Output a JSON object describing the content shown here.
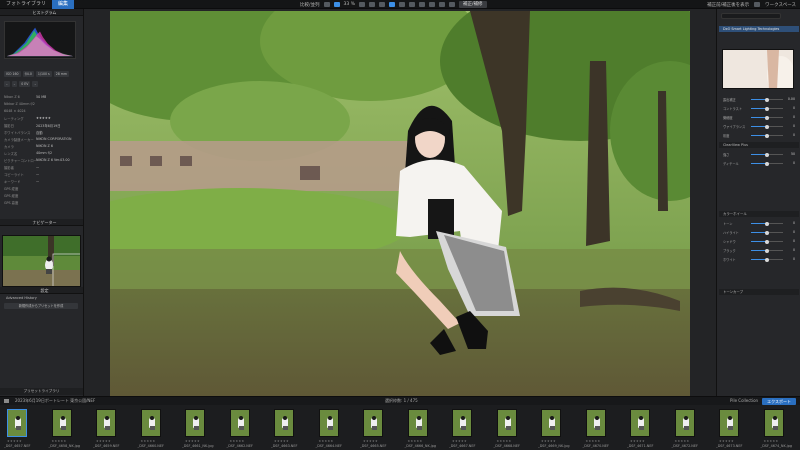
{
  "topbar": {
    "tabs": [
      "フォトライブラリ",
      "編集"
    ],
    "active_tab": "編集",
    "zoom": "33 %",
    "compare_label": "比較/並列",
    "tool_button": "補正/補修",
    "right_label": "補正前/補正後を表示",
    "right_label2": "ワークスペース"
  },
  "left_panel": {
    "histogram_title": "ヒストグラム",
    "buttons_row1": [
      "ISO 160",
      "1/60",
      "1/100 s",
      "28 mm",
      "f/4.0"
    ],
    "buttons_row2": [
      "–",
      "–",
      "0 EV",
      "–"
    ],
    "meta": [
      {
        "k": "Nikon Z 6",
        "v": "50 MB"
      },
      {
        "k": "Nikkor Z 40mm f/2",
        "v": ""
      },
      {
        "k": "6048 × 4024",
        "v": ""
      },
      {
        "k": "レーティング",
        "v": "★★★★★"
      },
      {
        "k": "撮影日",
        "v": "2023年6月19日"
      },
      {
        "k": "ホワイトバランス",
        "v": "自動"
      },
      {
        "k": "カメラ製造メーカー",
        "v": "NIKON CORPORATION"
      },
      {
        "k": "カメラ",
        "v": "NIKON Z 6"
      },
      {
        "k": "レンズ名",
        "v": "40mm f/2"
      },
      {
        "k": "ピクチャーコントロール",
        "v": "NIKON Z 6 Ver.03.00"
      },
      {
        "k": "撮影者",
        "v": "—"
      },
      {
        "k": "コピーライト",
        "v": "—"
      },
      {
        "k": "キーワード",
        "v": "—"
      },
      {
        "k": "GPS 緯度",
        "v": ""
      },
      {
        "k": "GPS 経度",
        "v": ""
      },
      {
        "k": "GPS 高度",
        "v": ""
      }
    ],
    "nav_title": "ナビゲーター",
    "advanced_section": "設定",
    "advanced_item": "Advanced History",
    "preset_button": "新規作成からプリセットを作成",
    "bottom_label": "プリセットライブラリ"
  },
  "right_panel": {
    "search_placeholder": "補正ツールを検索",
    "section1": "DxO Smart Lighting Technologies",
    "thumb_label": "補正前",
    "sliders": [
      {
        "label": "露出補正",
        "value": "0.00",
        "pos": 0.5
      },
      {
        "label": "コントラスト",
        "value": "0",
        "pos": 0.5
      },
      {
        "label": "微細度",
        "value": "0",
        "pos": 0.5
      },
      {
        "label": "ヴァイブランス",
        "value": "0",
        "pos": 0.5
      },
      {
        "label": "彩度",
        "value": "0",
        "pos": 0.5
      }
    ],
    "section2": "ClearView Plus",
    "sliders2": [
      {
        "label": "強さ",
        "value": "50",
        "pos": 0.5
      },
      {
        "label": "ディテール",
        "value": "0",
        "pos": 0.5
      }
    ],
    "section3": "カラーホイール",
    "sliders3": [
      {
        "label": "トーン",
        "value": "0",
        "pos": 0.5
      },
      {
        "label": "ハイライト",
        "value": "0",
        "pos": 0.5
      },
      {
        "label": "シャドウ",
        "value": "0",
        "pos": 0.5
      },
      {
        "label": "ブラック",
        "value": "0",
        "pos": 0.5
      },
      {
        "label": "ホワイト",
        "value": "0",
        "pos": 0.5
      }
    ],
    "section4": "トーンカーブ"
  },
  "filmstrip": {
    "folder": "2023年6月19日ポートレート 東京公園/NEF",
    "center_label": "選択枠数: 1 / 475",
    "collection": "Pile Collection",
    "export_label": "エクスポート",
    "thumbs": [
      "_DSF_4657.NEF",
      "_DSF_4658_NK.jpg",
      "_DSF_4659.NEF",
      "_DSF_4660.NEF",
      "_DSF_4661_NK.jpg",
      "_DSF_4662.NEF",
      "_DSF_4663.NEF",
      "_DSF_4664.NEF",
      "_DSF_4665.NEF",
      "_DSF_4666_NK.jpg",
      "_DSF_4667.NEF",
      "_DSF_4668.NEF",
      "_DSF_4669_NK.jpg",
      "_DSF_4670.NEF",
      "_DSF_4671.NEF",
      "_DSF_4672.NEF",
      "_DSF_4673.NEF",
      "_DSF_4674_NK.jpg"
    ],
    "selected_index": 0
  }
}
